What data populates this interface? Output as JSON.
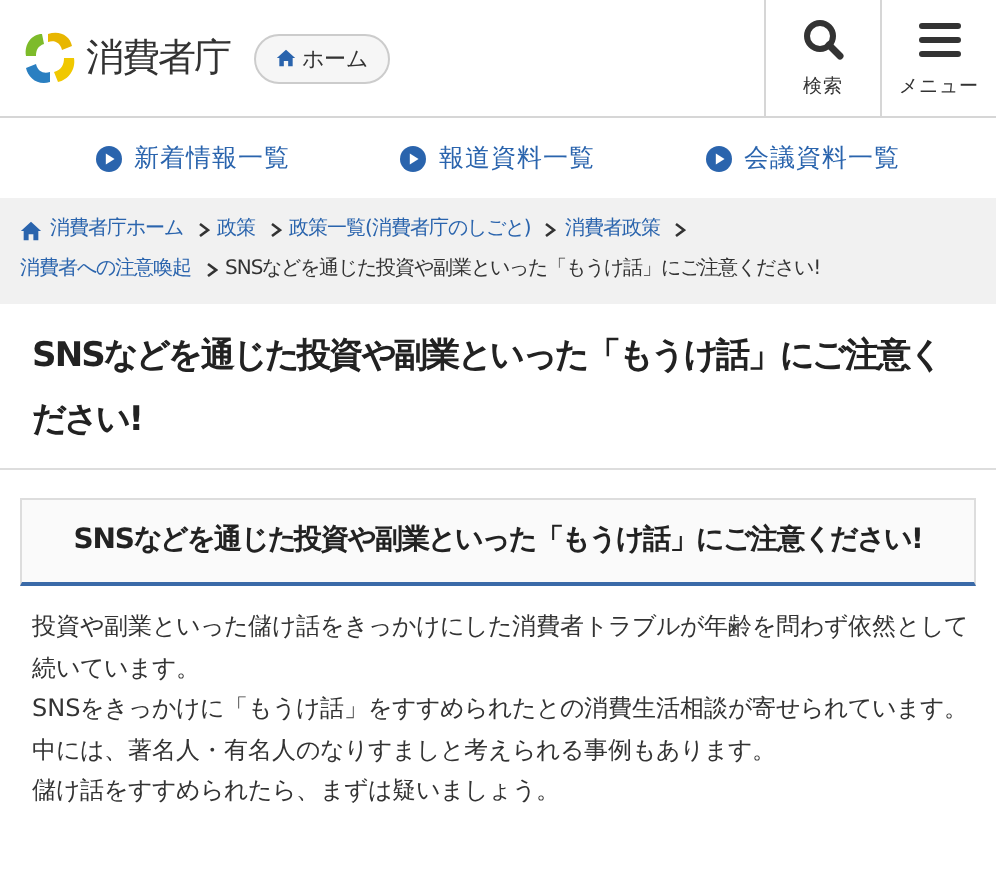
{
  "header": {
    "logo_text": "消費者庁",
    "home_button": "ホーム",
    "actions": [
      {
        "kind": "search",
        "label": "検索"
      },
      {
        "kind": "menu",
        "label": "メニュー"
      }
    ]
  },
  "quick_links": [
    "新着情報一覧",
    "報道資料一覧",
    "会議資料一覧"
  ],
  "breadcrumb": {
    "links": [
      "消費者庁ホーム",
      "政策",
      "政策一覧(消費者庁のしごと)",
      "消費者政策",
      "消費者への注意喚起"
    ],
    "current": "SNSなどを通じた投資や副業といった「もうけ話」にご注意ください!"
  },
  "page_title": "SNSなどを通じた投資や副業といった「もうけ話」にご注意ください!",
  "section_heading": "SNSなどを通じた投資や副業といった「もうけ話」にご注意ください!",
  "paragraphs": [
    "投資や副業といった儲け話をきっかけにした消費者トラブルが年齢を問わず依然として続いています。",
    "SNSをきっかけに「もうけ話」をすすめられたとの消費生活相談が寄せられています。",
    "中には、著名人・有名人のなりすましと考えられる事例もあります。",
    "儲け話をすすめられたら、まずは疑いましょう。"
  ]
}
